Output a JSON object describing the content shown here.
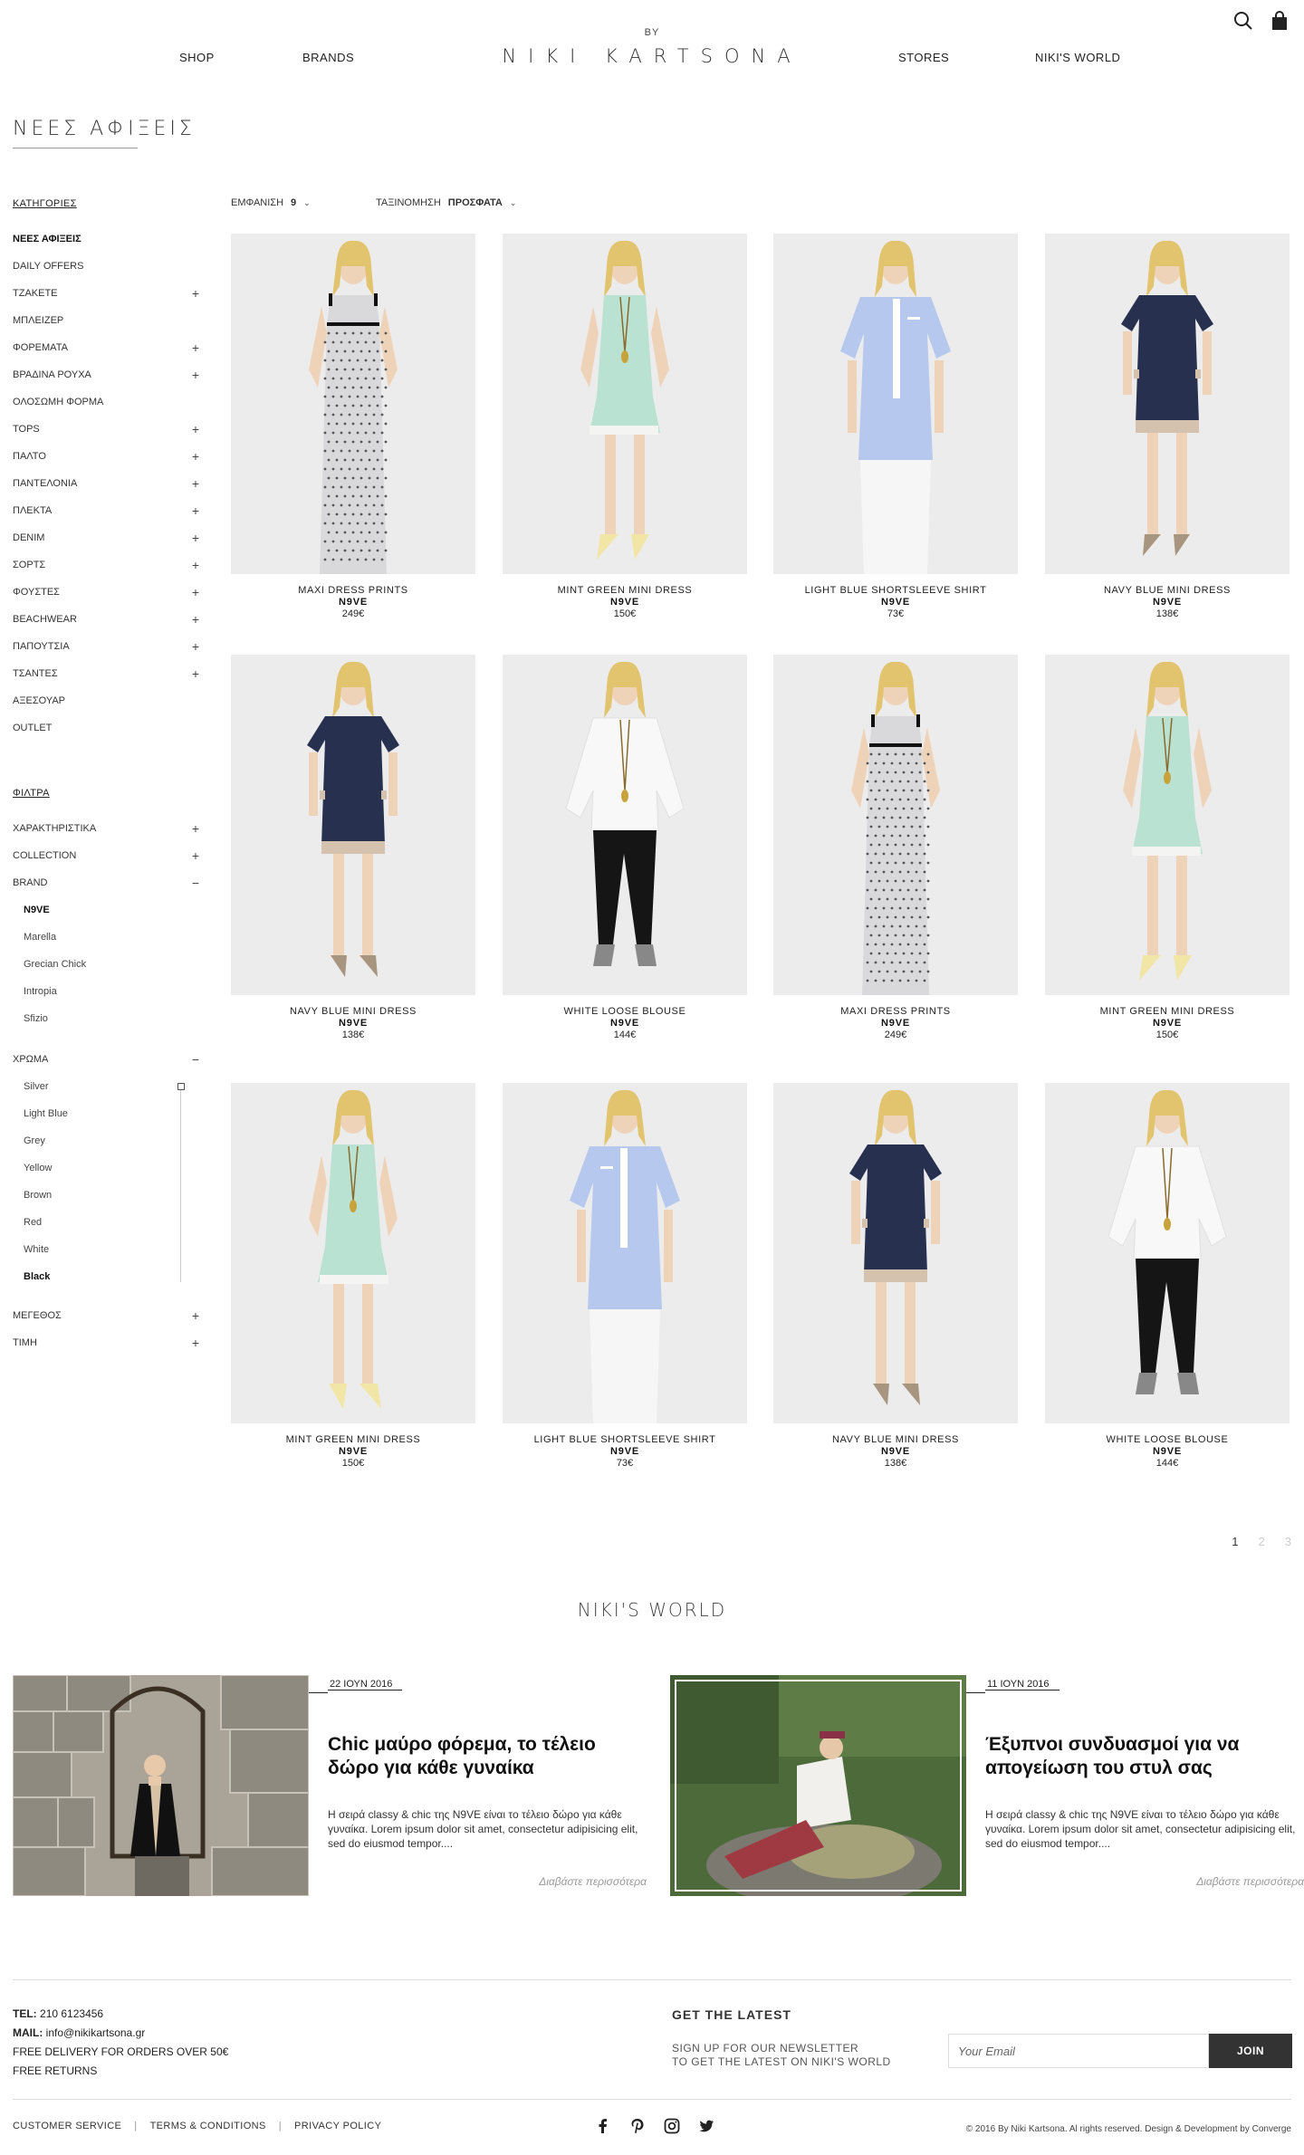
{
  "header": {
    "nav_left": [
      "SHOP",
      "BRANDS"
    ],
    "nav_right": [
      "STORES",
      "NIKI'S WORLD"
    ],
    "logo_by": "BY",
    "logo": "NIKI KARTSONA"
  },
  "page_title": "ΝΕΕΣ ΑΦΙΞΕΙΣ",
  "sidebar": {
    "categories_heading": "ΚΑΤΗΓΟΡΙΕΣ",
    "categories": [
      {
        "label": "ΝΕΕΣ ΑΦΙΞΕΙΣ",
        "sign": ""
      },
      {
        "label": "DAILY OFFERS",
        "sign": ""
      },
      {
        "label": "ΤΖΑΚΕΤΕ",
        "sign": "+"
      },
      {
        "label": "ΜΠΛΕΙΖΕΡ",
        "sign": ""
      },
      {
        "label": "ΦΟΡΕΜΑΤΑ",
        "sign": "+"
      },
      {
        "label": "ΒΡΑΔΙΝΑ ΡΟΥΧΑ",
        "sign": "+"
      },
      {
        "label": "ΟΛΟΣΩΜΗ ΦΟΡΜΑ",
        "sign": ""
      },
      {
        "label": "TOPS",
        "sign": "+"
      },
      {
        "label": "ΠΑΛΤΟ",
        "sign": "+"
      },
      {
        "label": "ΠΑΝΤΕΛΟΝΙΑ",
        "sign": "+"
      },
      {
        "label": "ΠΛΕΚΤΑ",
        "sign": "+"
      },
      {
        "label": "DENIM",
        "sign": "+"
      },
      {
        "label": "ΣΟΡΤΣ",
        "sign": "+"
      },
      {
        "label": "ΦΟΥΣΤΕΣ",
        "sign": "+"
      },
      {
        "label": "BEACHWEAR",
        "sign": "+"
      },
      {
        "label": "ΠΑΠΟΥΤΣΙΑ",
        "sign": "+"
      },
      {
        "label": "ΤΣΑΝΤΕΣ",
        "sign": "+"
      },
      {
        "label": "ΑΞΕΣΟΥΑΡ",
        "sign": ""
      },
      {
        "label": "OUTLET",
        "sign": ""
      }
    ],
    "filters_heading": "ΦΙΛΤΡΑ",
    "filters": {
      "features": {
        "label": "ΧΑΡΑΚΤΗΡΙΣΤΙΚΑ",
        "sign": "+"
      },
      "collection": {
        "label": "COLLECTION",
        "sign": "+"
      },
      "brand": {
        "label": "BRAND",
        "sign": "−"
      },
      "brands": [
        "N9VE",
        "Marella",
        "Grecian Chick",
        "Intropia",
        "Sfizio"
      ],
      "color": {
        "label": "ΧΡΩΜΑ",
        "sign": "−"
      },
      "colors": [
        "Silver",
        "Light Blue",
        "Grey",
        "Yellow",
        "Brown",
        "Red",
        "White",
        "Black"
      ],
      "size": {
        "label": "ΜΕΓΕΘΟΣ",
        "sign": "+"
      },
      "price": {
        "label": "ΤΙΜΗ",
        "sign": "+"
      }
    }
  },
  "toolbar": {
    "show_label": "ΕΜΦΑΝΙΣΗ",
    "show_value": "9",
    "sort_label": "ΤΑΞΙΝΟΜΗΣΗ",
    "sort_value": "ΠΡΟΣΦΑΤΑ"
  },
  "products": [
    {
      "name": "MAXI DRESS PRINTS",
      "brand": "N9VE",
      "price": "249€"
    },
    {
      "name": "MINT GREEN MINI DRESS",
      "brand": "N9VE",
      "price": "150€"
    },
    {
      "name": "LIGHT BLUE SHORTSLEEVE SHIRT",
      "brand": "N9VE",
      "price": "73€"
    },
    {
      "name": "NAVY BLUE MINI DRESS",
      "brand": "N9VE",
      "price": "138€"
    },
    {
      "name": "NAVY BLUE MINI DRESS",
      "brand": "N9VE",
      "price": "138€"
    },
    {
      "name": "WHITE LOOSE BLOUSE",
      "brand": "N9VE",
      "price": "144€"
    },
    {
      "name": "MAXI DRESS PRINTS",
      "brand": "N9VE",
      "price": "249€"
    },
    {
      "name": "MINT GREEN MINI DRESS",
      "brand": "N9VE",
      "price": "150€"
    },
    {
      "name": "MINT GREEN MINI DRESS",
      "brand": "N9VE",
      "price": "150€"
    },
    {
      "name": "LIGHT BLUE SHORTSLEEVE SHIRT",
      "brand": "N9VE",
      "price": "73€"
    },
    {
      "name": "NAVY BLUE MINI DRESS",
      "brand": "N9VE",
      "price": "138€"
    },
    {
      "name": "WHITE LOOSE BLOUSE",
      "brand": "N9VE",
      "price": "144€"
    }
  ],
  "pagination": [
    "1",
    "2",
    "3"
  ],
  "world": {
    "title": "NIKI'S WORLD",
    "posts": [
      {
        "date": "22 ΙΟΥΝ 2016",
        "title": "Chic μαύρο φόρεμα, το τέλειο δώρο για κάθε γυναίκα",
        "excerpt": "Η σειρά classy & chic της N9VE είναι το τέλειο δώρο για κάθε γυναίκα. Lorem ipsum dolor sit amet, consectetur adipisicing elit, sed do eiusmod tempor....",
        "more": "Διαβάστε περισσότερα"
      },
      {
        "date": "11 ΙΟΥΝ 2016",
        "title": "Έξυπνοι συνδυασμοί για να απογείωση του στυλ σας",
        "excerpt": "Η σειρά classy & chic της N9VE είναι το τέλειο δώρο για κάθε γυναίκα. Lorem ipsum dolor sit amet, consectetur adipisicing elit, sed do eiusmod tempor....",
        "more": "Διαβάστε περισσότερα"
      }
    ]
  },
  "footer": {
    "tel_label": "TEL:",
    "tel": "210 6123456",
    "mail_label": "MAIL:",
    "mail": "info@nikikartsona.gr",
    "free_delivery": "FREE DELIVERY FOR ORDERS OVER 50€",
    "free_returns": "FREE RETURNS",
    "newsletter_heading": "GET THE LATEST",
    "newsletter_line1": "SIGN UP FOR OUR NEWSLETTER",
    "newsletter_line2": "TO GET THE LATEST ON NIKI'S WORLD",
    "email_placeholder": "Your Email",
    "join": "JOIN",
    "links": [
      "CUSTOMER SERVICE",
      "TERMS & CONDITIONS",
      "PRIVACY POLICY"
    ],
    "separator": "|",
    "copyright": "© 2016 By Niki Kartsona. Al rights reserved. Design & Development by Converge"
  }
}
